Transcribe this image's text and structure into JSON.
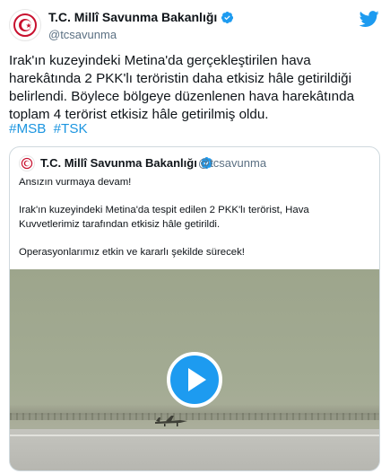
{
  "tweet": {
    "author_name": "T.C. Millî Savunma Bakanlığı",
    "author_handle": "@tcsavunma",
    "text": "Irak'ın kuzeyindeki Metina'da gerçekleştirilen hava harekâtında 2 PKK'lı teröristin daha etkisiz hâle getirildiği belirlendi. Böylece bölgeye düzenlenen hava harekâtında toplam 4 terörist etkisiz hâle getirilmiş oldu.",
    "hashtags": [
      "#MSB",
      "#TSK"
    ]
  },
  "quoted": {
    "author_name": "T.C. Millî Savunma Bakanlığı",
    "author_handle": "@tcsavunma",
    "paragraphs": [
      "Ansızın vurmaya devam!",
      "Irak'ın kuzeyindeki Metina'da tespit edilen 2 PKK'lı terörist, Hava Kuvvetlerimiz tarafından etkisiz hâle getirildi.",
      "Operasyonlarımız etkin ve kararlı şekilde sürecek!"
    ]
  },
  "colors": {
    "accent": "#1d9bf0",
    "hashtag": "#1b95e0",
    "handle": "#5b7083",
    "logo_red": "#c8102e"
  },
  "icons": {
    "avatar": "msb-emblem",
    "verified": "verified-badge-icon",
    "brand": "twitter-bird-icon",
    "video": "play-icon"
  }
}
